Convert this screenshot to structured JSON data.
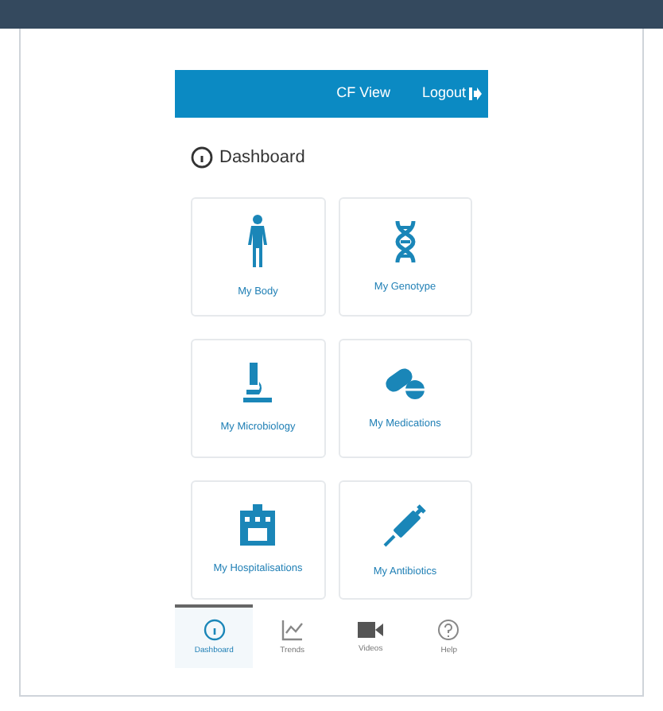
{
  "app_bar": {
    "title": "CF View",
    "logout": "Logout"
  },
  "heading": "Dashboard",
  "tiles": [
    {
      "kind": "body",
      "label": "My Body"
    },
    {
      "kind": "dna",
      "label": "My Genotype"
    },
    {
      "kind": "microscope",
      "label": "My Microbiology"
    },
    {
      "kind": "pills",
      "label": "My Medications"
    },
    {
      "kind": "hospital",
      "label": "My Hospitalisations"
    },
    {
      "kind": "syringe",
      "label": "My Antibiotics"
    }
  ],
  "nav": [
    {
      "kind": "dashboard",
      "label": "Dashboard",
      "selected": true
    },
    {
      "kind": "trends",
      "label": "Trends",
      "selected": false
    },
    {
      "kind": "videos",
      "label": "Videos",
      "selected": false
    },
    {
      "kind": "help",
      "label": "Help",
      "selected": false
    }
  ]
}
